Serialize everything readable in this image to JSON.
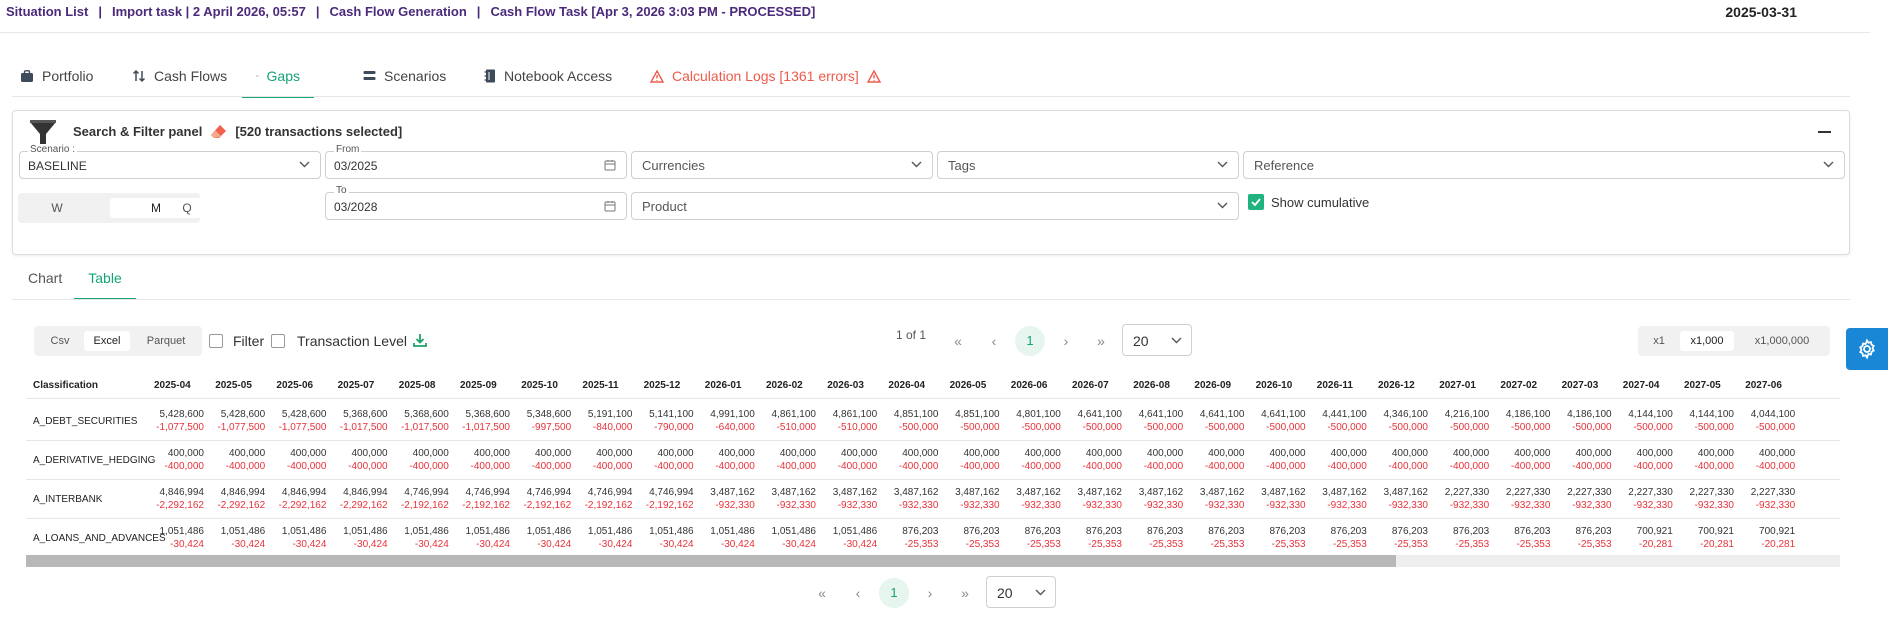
{
  "header": {
    "breadcrumb": [
      "Situation List",
      "Import task | 2 April 2026, 05:57",
      "Cash Flow Generation",
      "Cash Flow Task [Apr 3, 2026 3:03 PM - PROCESSED]"
    ],
    "date": "2025-03-31"
  },
  "tabs": [
    {
      "label": "Portfolio",
      "icon": "briefcase-icon"
    },
    {
      "label": "Cash Flows",
      "icon": "arrows-updown-icon"
    },
    {
      "label": "Gaps",
      "icon": "gap-icon",
      "active": true
    },
    {
      "label": "Scenarios",
      "icon": "layers-icon"
    },
    {
      "label": "Notebook Access",
      "icon": "notebook-icon"
    },
    {
      "label": "Calculation Logs [1361 errors]",
      "icon": "warning-icon",
      "warn": true
    }
  ],
  "filter": {
    "title": "Search & Filter panel",
    "selected": "[520 transactions selected]",
    "scenario_label": "Scenario :",
    "scenario_value": "BASELINE",
    "from_label": "From",
    "from_value": "03/2025",
    "to_label": "To",
    "to_value": "03/2028",
    "currencies_placeholder": "Currencies",
    "tags_placeholder": "Tags",
    "reference_placeholder": "Reference",
    "product_placeholder": "Product",
    "periods": [
      "W",
      "M",
      "Q"
    ],
    "period_selected": "M",
    "show_cumulative": "Show cumulative"
  },
  "view_tabs": [
    "Chart",
    "Table"
  ],
  "toolbar": {
    "formats": [
      "Csv",
      "Excel",
      "Parquet"
    ],
    "format_selected": "Excel",
    "filter_label": "Filter",
    "transaction_level_label": "Transaction Level",
    "page_info": "1 of 1",
    "current_page": "1",
    "page_size": "20",
    "scales": [
      "x1",
      "x1,000",
      "x1,000,000"
    ],
    "scale_selected": "x1,000"
  },
  "table": {
    "first_header": "Classification",
    "columns": [
      "2025-04",
      "2025-05",
      "2025-06",
      "2025-07",
      "2025-08",
      "2025-09",
      "2025-10",
      "2025-11",
      "2025-12",
      "2026-01",
      "2026-02",
      "2026-03",
      "2026-04",
      "2026-05",
      "2026-06",
      "2026-07",
      "2026-08",
      "2026-09",
      "2026-10",
      "2026-11",
      "2026-12",
      "2027-01",
      "2027-02",
      "2027-03",
      "2027-04",
      "2027-05",
      "2027-06"
    ],
    "rows": [
      {
        "name": "A_DEBT_SECURITIES",
        "a": [
          "5,428,600",
          "5,428,600",
          "5,428,600",
          "5,368,600",
          "5,368,600",
          "5,368,600",
          "5,348,600",
          "5,191,100",
          "5,141,100",
          "4,991,100",
          "4,861,100",
          "4,861,100",
          "4,851,100",
          "4,851,100",
          "4,801,100",
          "4,641,100",
          "4,641,100",
          "4,641,100",
          "4,641,100",
          "4,441,100",
          "4,346,100",
          "4,216,100",
          "4,186,100",
          "4,186,100",
          "4,144,100",
          "4,144,100",
          "4,044,100"
        ],
        "b": [
          "-1,077,500",
          "-1,077,500",
          "-1,077,500",
          "-1,017,500",
          "-1,017,500",
          "-1,017,500",
          "-997,500",
          "-840,000",
          "-790,000",
          "-640,000",
          "-510,000",
          "-510,000",
          "-500,000",
          "-500,000",
          "-500,000",
          "-500,000",
          "-500,000",
          "-500,000",
          "-500,000",
          "-500,000",
          "-500,000",
          "-500,000",
          "-500,000",
          "-500,000",
          "-500,000",
          "-500,000",
          "-500,000"
        ]
      },
      {
        "name": "A_DERIVATIVE_HEDGING",
        "a": [
          "400,000",
          "400,000",
          "400,000",
          "400,000",
          "400,000",
          "400,000",
          "400,000",
          "400,000",
          "400,000",
          "400,000",
          "400,000",
          "400,000",
          "400,000",
          "400,000",
          "400,000",
          "400,000",
          "400,000",
          "400,000",
          "400,000",
          "400,000",
          "400,000",
          "400,000",
          "400,000",
          "400,000",
          "400,000",
          "400,000",
          "400,000"
        ],
        "b": [
          "-400,000",
          "-400,000",
          "-400,000",
          "-400,000",
          "-400,000",
          "-400,000",
          "-400,000",
          "-400,000",
          "-400,000",
          "-400,000",
          "-400,000",
          "-400,000",
          "-400,000",
          "-400,000",
          "-400,000",
          "-400,000",
          "-400,000",
          "-400,000",
          "-400,000",
          "-400,000",
          "-400,000",
          "-400,000",
          "-400,000",
          "-400,000",
          "-400,000",
          "-400,000",
          "-400,000"
        ]
      },
      {
        "name": "A_INTERBANK",
        "a": [
          "4,846,994",
          "4,846,994",
          "4,846,994",
          "4,846,994",
          "4,746,994",
          "4,746,994",
          "4,746,994",
          "4,746,994",
          "4,746,994",
          "3,487,162",
          "3,487,162",
          "3,487,162",
          "3,487,162",
          "3,487,162",
          "3,487,162",
          "3,487,162",
          "3,487,162",
          "3,487,162",
          "3,487,162",
          "3,487,162",
          "3,487,162",
          "2,227,330",
          "2,227,330",
          "2,227,330",
          "2,227,330",
          "2,227,330",
          "2,227,330"
        ],
        "b": [
          "-2,292,162",
          "-2,292,162",
          "-2,292,162",
          "-2,292,162",
          "-2,192,162",
          "-2,192,162",
          "-2,192,162",
          "-2,192,162",
          "-2,192,162",
          "-932,330",
          "-932,330",
          "-932,330",
          "-932,330",
          "-932,330",
          "-932,330",
          "-932,330",
          "-932,330",
          "-932,330",
          "-932,330",
          "-932,330",
          "-932,330",
          "-932,330",
          "-932,330",
          "-932,330",
          "-932,330",
          "-932,330",
          "-932,330"
        ]
      },
      {
        "name": "A_LOANS_AND_ADVANCES",
        "a": [
          "1,051,486",
          "1,051,486",
          "1,051,486",
          "1,051,486",
          "1,051,486",
          "1,051,486",
          "1,051,486",
          "1,051,486",
          "1,051,486",
          "1,051,486",
          "1,051,486",
          "1,051,486",
          "876,203",
          "876,203",
          "876,203",
          "876,203",
          "876,203",
          "876,203",
          "876,203",
          "876,203",
          "876,203",
          "876,203",
          "876,203",
          "876,203",
          "700,921",
          "700,921",
          "700,921"
        ],
        "b": [
          "-30,424",
          "-30,424",
          "-30,424",
          "-30,424",
          "-30,424",
          "-30,424",
          "-30,424",
          "-30,424",
          "-30,424",
          "-30,424",
          "-30,424",
          "-30,424",
          "-25,353",
          "-25,353",
          "-25,353",
          "-25,353",
          "-25,353",
          "-25,353",
          "-25,353",
          "-25,353",
          "-25,353",
          "-25,353",
          "-25,353",
          "-25,353",
          "-20,281",
          "-20,281",
          "-20,281"
        ]
      }
    ]
  },
  "colors": {
    "accent": "#16a37a",
    "negative": "#e8323a",
    "brand": "#4b2a7b",
    "warning": "#f05a4a",
    "gear": "#1a86d6"
  }
}
